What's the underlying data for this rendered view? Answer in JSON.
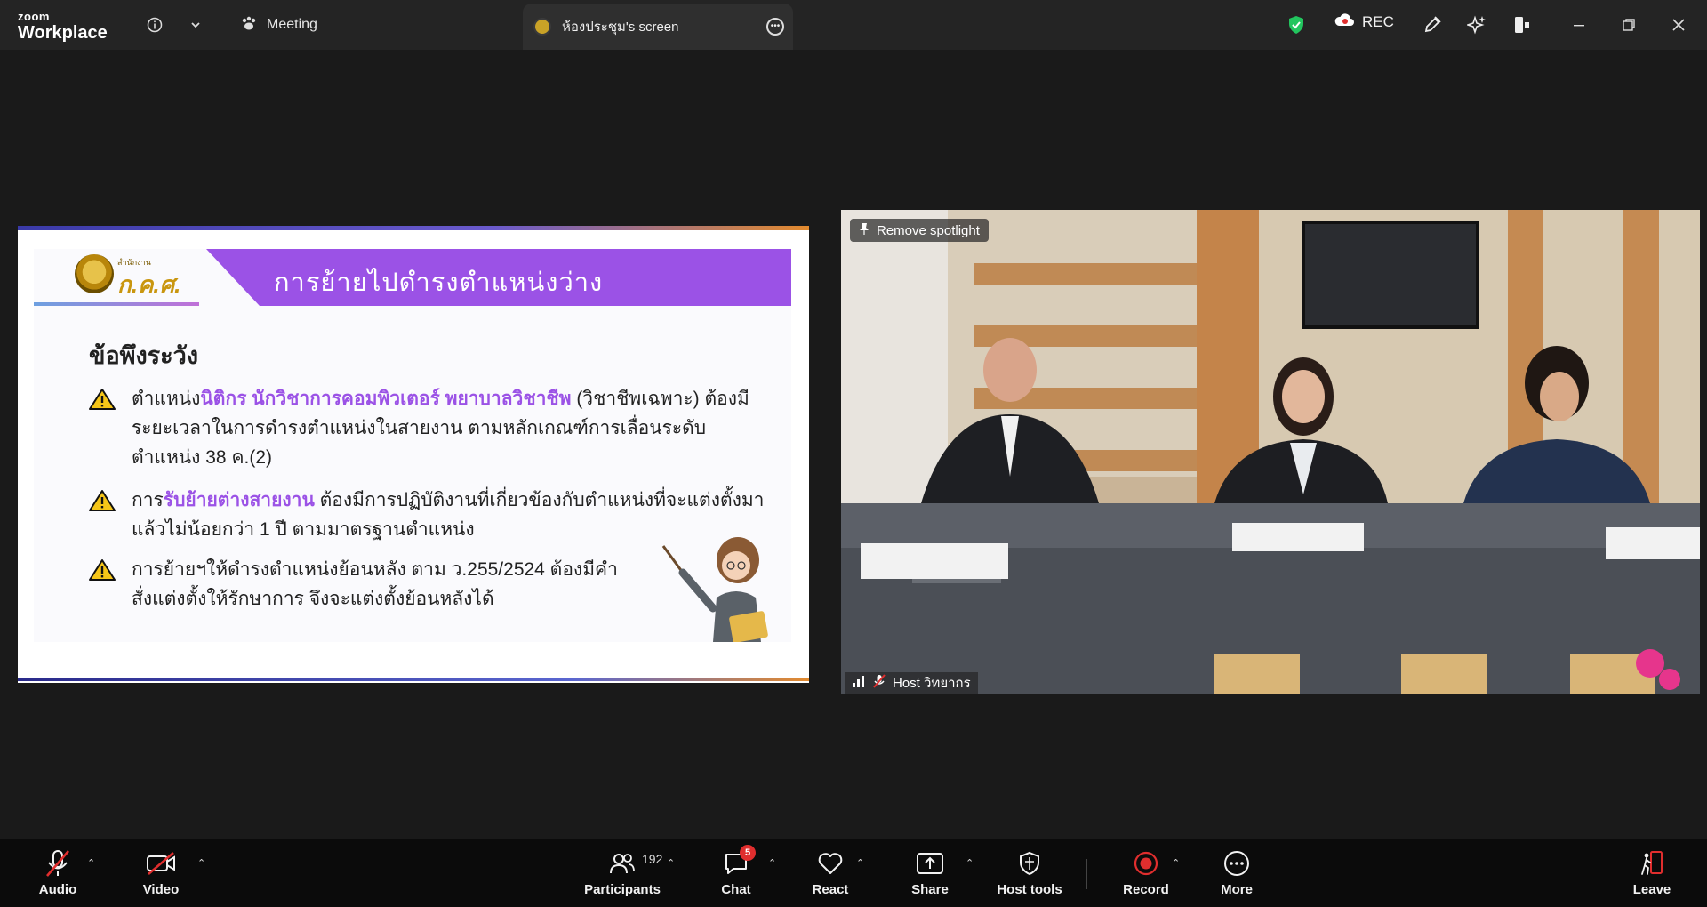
{
  "titlebar": {
    "brand_top": "zoom",
    "brand_bottom": "Workplace",
    "meeting_label": "Meeting",
    "screen_tab_label": "ห้องประชุม's screen",
    "rec_label": "REC"
  },
  "slide": {
    "logo_small": "สำนักงาน",
    "logo_text": "ก.ค.ศ.",
    "banner_title": "การย้ายไปดำรงตำแหน่งว่าง",
    "heading": "ข้อพึงระวัง",
    "bullet1_pre": "ตำแหน่ง",
    "bullet1_hl": "นิติกร นักวิชาการคอมพิวเตอร์ พยาบาลวิชาชีพ",
    "bullet1_post": " (วิชาชีพเฉพาะ) ต้องมีระยะเวลาในการดำรงตำแหน่งในสายงาน ตามหลักเกณฑ์การเลื่อนระดับตำแหน่ง 38 ค.(2)",
    "bullet2_pre": "การ",
    "bullet2_hl": "รับย้ายต่างสายงาน",
    "bullet2_post": " ต้องมีการปฏิบัติงานที่เกี่ยวข้องกับตำแหน่งที่จะแต่งตั้งมาแล้วไม่น้อยกว่า 1 ปี ตามมาตรฐานตำแหน่ง",
    "bullet3": "การย้ายฯให้ดำรงตำแหน่งย้อนหลัง ตาม ว.255/2524 ต้องมีคำสั่งแต่งตั้งให้รักษาการ จึงจะแต่งตั้งย้อนหลังได้"
  },
  "video": {
    "spotlight_button": "Remove spotlight",
    "participant_name": "Host วิทยากร"
  },
  "toolbar": {
    "audio": "Audio",
    "video": "Video",
    "participants": "Participants",
    "participants_count": "192",
    "chat": "Chat",
    "chat_badge": "5",
    "react": "React",
    "share": "Share",
    "host_tools": "Host tools",
    "record": "Record",
    "more": "More",
    "leave": "Leave"
  }
}
